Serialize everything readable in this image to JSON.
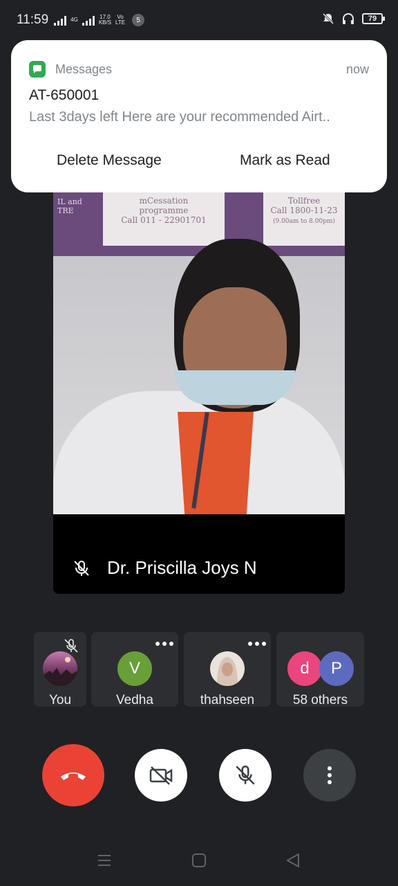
{
  "status_bar": {
    "time": "11:59",
    "net1": "4G",
    "speed_value": "17.0",
    "speed_unit": "KB/S",
    "volte_top": "Vo",
    "volte_bottom": "LTE",
    "notification_count": "5",
    "battery": "79"
  },
  "notification": {
    "app_name": "Messages",
    "time": "now",
    "title": "AT-650001",
    "body": "Last 3days left Here are your recommended Airt..",
    "action_delete": "Delete Message",
    "action_read": "Mark as Read",
    "accent_color": "#34a853"
  },
  "main_video": {
    "speaker_name": "Dr. Priscilla Joys N",
    "poster_left_line1": "IL and",
    "poster_left_line2": "TRE",
    "poster_mid_line1": "mCessation",
    "poster_mid_line2": "programme",
    "poster_mid_line3": "Call 011 - 22901701",
    "poster_right_line1": "Tollfree",
    "poster_right_line2": "Call 1800-11-23",
    "poster_right_line3": "(9.00am to 8.00pm)"
  },
  "participants": [
    {
      "name": "You",
      "icon": "user-photo",
      "muted": true
    },
    {
      "name": "Vedha",
      "initial": "V",
      "color": "#689f38"
    },
    {
      "name": "thahseen",
      "icon": "user-photo"
    },
    {
      "name": "58 others",
      "initials": [
        "d",
        "P"
      ],
      "colors": [
        "#e8467c",
        "#5c6bc0"
      ]
    }
  ],
  "controls": {
    "end_call_color": "#ea4335",
    "icons": [
      "end-call-icon",
      "camera-off-icon",
      "mic-off-icon",
      "more-vert-icon"
    ]
  },
  "nav_icons": [
    "recents-icon",
    "home-icon",
    "back-icon"
  ]
}
